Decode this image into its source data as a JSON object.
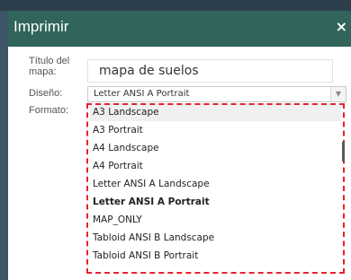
{
  "dialog": {
    "title": "Imprimir",
    "close_glyph": "×",
    "map_title_label": "Título del mapa:",
    "map_title_value": "mapa de suelos",
    "layout_label": "Diseño:",
    "layout_selected": "Letter ANSI A Portrait",
    "format_label": "Formato:"
  },
  "dropdown": {
    "options": [
      "A3 Landscape",
      "A3 Portrait",
      "A4 Landscape",
      "A4 Portrait",
      "Letter ANSI A Landscape",
      "Letter ANSI A Portrait",
      "MAP_ONLY",
      "Tabloid ANSI B Landscape",
      "Tabloid ANSI B Portrait"
    ],
    "selected_index": 5
  },
  "colors": {
    "titlebar": "#31645a",
    "highlight_border": "#e8212c"
  },
  "icons": {
    "close": "close-icon",
    "select_arrow": "chevron-down-icon"
  }
}
